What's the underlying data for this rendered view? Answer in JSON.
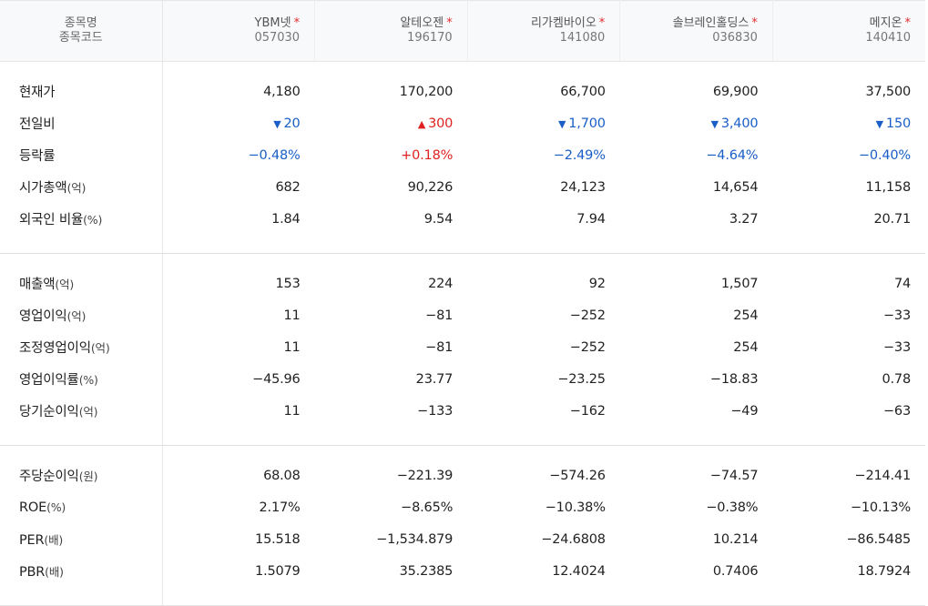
{
  "header": {
    "label_line1": "종목명",
    "label_line2": "종목코드"
  },
  "companies": [
    {
      "name": "YBM넷",
      "code": "057030",
      "star": "*"
    },
    {
      "name": "알테오젠",
      "code": "196170",
      "star": "*"
    },
    {
      "name": "리가켐바이오",
      "code": "141080",
      "star": "*"
    },
    {
      "name": "솔브레인홀딩스",
      "code": "036830",
      "star": "*"
    },
    {
      "name": "메지온",
      "code": "140410",
      "star": "*"
    }
  ],
  "groups": [
    {
      "rows": [
        {
          "label": "현재가",
          "unit": "",
          "values": [
            {
              "v": "4,180"
            },
            {
              "v": "170,200"
            },
            {
              "v": "66,700"
            },
            {
              "v": "69,900"
            },
            {
              "v": "37,500"
            }
          ]
        },
        {
          "label": "전일비",
          "unit": "",
          "values": [
            {
              "v": "20",
              "dir": "down",
              "icon": "▼"
            },
            {
              "v": "300",
              "dir": "up",
              "icon": "▲"
            },
            {
              "v": "1,700",
              "dir": "down",
              "icon": "▼"
            },
            {
              "v": "3,400",
              "dir": "down",
              "icon": "▼"
            },
            {
              "v": "150",
              "dir": "down",
              "icon": "▼"
            }
          ]
        },
        {
          "label": "등락률",
          "unit": "",
          "values": [
            {
              "v": "−0.48%",
              "dir": "down"
            },
            {
              "v": "+0.18%",
              "dir": "up"
            },
            {
              "v": "−2.49%",
              "dir": "down"
            },
            {
              "v": "−4.64%",
              "dir": "down"
            },
            {
              "v": "−0.40%",
              "dir": "down"
            }
          ]
        },
        {
          "label": "시가총액",
          "unit": "(억)",
          "values": [
            {
              "v": "682"
            },
            {
              "v": "90,226"
            },
            {
              "v": "24,123"
            },
            {
              "v": "14,654"
            },
            {
              "v": "11,158"
            }
          ]
        },
        {
          "label": "외국인 비율",
          "unit": "(%)",
          "values": [
            {
              "v": "1.84"
            },
            {
              "v": "9.54"
            },
            {
              "v": "7.94"
            },
            {
              "v": "3.27"
            },
            {
              "v": "20.71"
            }
          ]
        }
      ]
    },
    {
      "rows": [
        {
          "label": "매출액",
          "unit": "(억)",
          "values": [
            {
              "v": "153"
            },
            {
              "v": "224"
            },
            {
              "v": "92"
            },
            {
              "v": "1,507"
            },
            {
              "v": "74"
            }
          ]
        },
        {
          "label": "영업이익",
          "unit": "(억)",
          "values": [
            {
              "v": "11"
            },
            {
              "v": "−81"
            },
            {
              "v": "−252"
            },
            {
              "v": "254"
            },
            {
              "v": "−33"
            }
          ]
        },
        {
          "label": "조정영업이익",
          "unit": "(억)",
          "values": [
            {
              "v": "11"
            },
            {
              "v": "−81"
            },
            {
              "v": "−252"
            },
            {
              "v": "254"
            },
            {
              "v": "−33"
            }
          ]
        },
        {
          "label": "영업이익률",
          "unit": "(%)",
          "values": [
            {
              "v": "−45.96"
            },
            {
              "v": "23.77"
            },
            {
              "v": "−23.25"
            },
            {
              "v": "−18.83"
            },
            {
              "v": "0.78"
            }
          ]
        },
        {
          "label": "당기순이익",
          "unit": "(억)",
          "values": [
            {
              "v": "11"
            },
            {
              "v": "−133"
            },
            {
              "v": "−162"
            },
            {
              "v": "−49"
            },
            {
              "v": "−63"
            }
          ]
        }
      ]
    },
    {
      "rows": [
        {
          "label": "주당순이익",
          "unit": "(원)",
          "values": [
            {
              "v": "68.08"
            },
            {
              "v": "−221.39"
            },
            {
              "v": "−574.26"
            },
            {
              "v": "−74.57"
            },
            {
              "v": "−214.41"
            }
          ]
        },
        {
          "label": "ROE",
          "unit": "(%)",
          "values": [
            {
              "v": "2.17%"
            },
            {
              "v": "−8.65%"
            },
            {
              "v": "−10.38%"
            },
            {
              "v": "−0.38%"
            },
            {
              "v": "−10.13%"
            }
          ]
        },
        {
          "label": "PER",
          "unit": "(배)",
          "values": [
            {
              "v": "15.518"
            },
            {
              "v": "−1,534.879"
            },
            {
              "v": "−24.6808"
            },
            {
              "v": "10.214"
            },
            {
              "v": "−86.5485"
            }
          ]
        },
        {
          "label": "PBR",
          "unit": "(배)",
          "values": [
            {
              "v": "1.5079"
            },
            {
              "v": "35.2385"
            },
            {
              "v": "12.4024"
            },
            {
              "v": "0.7406"
            },
            {
              "v": "18.7924"
            }
          ]
        }
      ]
    }
  ],
  "colors": {
    "up": "#e02020",
    "down": "#1a5ec8",
    "star": "#e02c2c"
  }
}
